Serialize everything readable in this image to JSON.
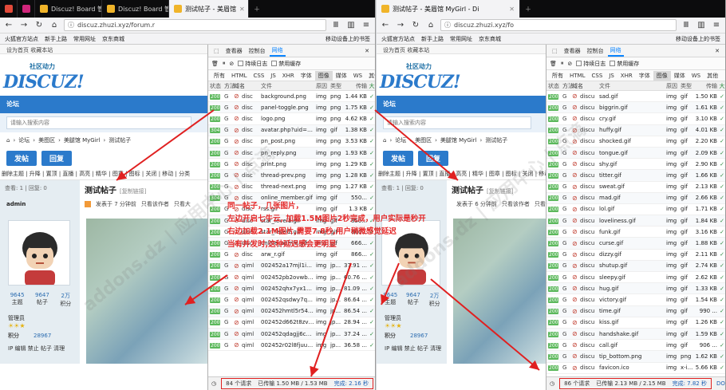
{
  "left": {
    "tabs": [
      {
        "label": "扰",
        "color": "#e24a3a",
        "active": false
      },
      {
        "label": "M",
        "color": "#d0267b",
        "active": false
      },
      {
        "label": "Discuz! Board 管",
        "color": "#f0b429",
        "active": false
      },
      {
        "label": "Discuz! Board 管",
        "color": "#f0b429",
        "active": false
      },
      {
        "label": "测试帖子 - 美眉馆",
        "color": "#f0b429",
        "active": true
      }
    ],
    "url": "discuz.zhuzi.xyz/forum.r",
    "bookmarks": [
      "火狐官方站点",
      "新手上路",
      "常用网址",
      "京东商城"
    ],
    "mobile_bm": "移动设备上的书签",
    "quicklinks": "设为首页  收藏本站",
    "logo_sub": "社区动力",
    "logo_main": "DISCUZ!",
    "forum_label": "论坛",
    "search_placeholder": "请输入搜索内容",
    "breadcrumb": [
      "论坛",
      "美图区",
      "美腿馆 MyGirl",
      "测试帖子"
    ],
    "post_btn": "发帖",
    "reply_btn": "回复",
    "types": "删除主题 | 升降 | 置顶 | 直播 | 高亮 | 精华 | 图章 | 图标 | 关闭 | 移动 | 分类",
    "stats": "查看: 1 | 回复: 0",
    "title": "测试帖子",
    "title_tag": "[复制链接]",
    "meta_time": "发表于 7 分钟前",
    "meta_author": "只看该作者",
    "meta_more": "只看大",
    "dev_tabs": [
      "查看器",
      "控制台",
      "网络"
    ],
    "dev_opts": [
      "持续日志",
      "禁用缓存"
    ],
    "filters": [
      "所有",
      "HTML",
      "CSS",
      "JS",
      "XHR",
      "字体",
      "图像",
      "媒体",
      "WS",
      "其他"
    ],
    "cols": [
      "状态",
      "方法",
      "域名",
      "文件",
      "原因",
      "类型",
      "传输",
      "大"
    ],
    "rows": [
      {
        "st": "200",
        "dom": "disc",
        "file": "background.png",
        "cause": "img",
        "type": "png",
        "size": "1.44 KB"
      },
      {
        "st": "200",
        "dom": "disc",
        "file": "panel-toggle.png",
        "cause": "img",
        "type": "png",
        "size": "1.75 KB"
      },
      {
        "st": "200",
        "dom": "disc",
        "file": "logo.png",
        "cause": "img",
        "type": "png",
        "size": "4.62 KB"
      },
      {
        "st": "304",
        "dom": "disc",
        "file": "avatar.php?uid=1...",
        "cause": "img",
        "type": "gif",
        "size": "1.38 KB"
      },
      {
        "st": "200",
        "dom": "disc",
        "file": "pn_post.png",
        "cause": "img",
        "type": "png",
        "size": "3.53 KB"
      },
      {
        "st": "200",
        "dom": "disc",
        "file": "pn_reply.png",
        "cause": "img",
        "type": "png",
        "size": "1.93 KB"
      },
      {
        "st": "200",
        "dom": "disc",
        "file": "print.png",
        "cause": "img",
        "type": "png",
        "size": "1.29 KB"
      },
      {
        "st": "200",
        "dom": "disc",
        "file": "thread-prev.png",
        "cause": "img",
        "type": "png",
        "size": "1.28 KB"
      },
      {
        "st": "200",
        "dom": "disc",
        "file": "thread-next.png",
        "cause": "img",
        "type": "png",
        "size": "1.27 KB"
      },
      {
        "st": "304",
        "dom": "disc",
        "file": "online_member.gif",
        "cause": "img",
        "type": "gif",
        "size": "550..."
      },
      {
        "st": "200",
        "dom": "disc",
        "file": "rss.gif",
        "cause": "img",
        "type": "gif",
        "size": "1.3 KB"
      },
      {
        "st": "200",
        "dom": "disc",
        "file": "star_level1.gif",
        "cause": "img",
        "type": "gif",
        "size": "850..."
      },
      {
        "st": "200",
        "dom": "disc",
        "file": "star_level2.gif",
        "cause": "img",
        "type": "gif",
        "size": "860..."
      },
      {
        "st": "200",
        "dom": "disc",
        "file": "online_admin.gif",
        "cause": "img",
        "type": "gif",
        "size": "666..."
      },
      {
        "st": "200",
        "dom": "disc",
        "file": "arw_r.gif",
        "cause": "img",
        "type": "gif",
        "size": "866..."
      },
      {
        "st": "200",
        "dom": "qiml",
        "file": "002452a17mjl1igx...",
        "cause": "img",
        "type": "jp...",
        "size": "37.91 ..."
      },
      {
        "st": "200",
        "dom": "qiml",
        "file": "002452pb2ovwbc...",
        "cause": "img",
        "type": "jp...",
        "size": "60.76 ..."
      },
      {
        "st": "200",
        "dom": "qiml",
        "file": "002452qhx7yx1q...",
        "cause": "img",
        "type": "jp...",
        "size": "81.09 ..."
      },
      {
        "st": "200",
        "dom": "qiml",
        "file": "002452qsdwy7qh...",
        "cause": "img",
        "type": "jp...",
        "size": "86.64 ..."
      },
      {
        "st": "200",
        "dom": "qiml",
        "file": "002452hmtl5r54rj...",
        "cause": "img",
        "type": "jp...",
        "size": "86.54 ..."
      },
      {
        "st": "200",
        "dom": "qiml",
        "file": "002452d662t8zva...",
        "cause": "img",
        "type": "jp...",
        "size": "28.94 ..."
      },
      {
        "st": "200",
        "dom": "qiml",
        "file": "002452qdagjj6csq...",
        "cause": "img",
        "type": "jp...",
        "size": "37.24 ..."
      },
      {
        "st": "200",
        "dom": "qiml",
        "file": "002452r02l8fjuu9...",
        "cause": "img",
        "type": "jp...",
        "size": "36.58 ..."
      }
    ],
    "footer_req": "84 个请求",
    "footer_xfer": "已传输 1.50 MB / 1.53 MB",
    "footer_done": "完成: 2.16 秒",
    "user": {
      "name": "admin",
      "topics": "9645",
      "posts": "9647",
      "credit": "2万",
      "topics_lbl": "主题",
      "posts_lbl": "帖子",
      "credit_lbl": "积分",
      "role": "管理员",
      "score_lbl": "积分",
      "score": "28967",
      "links": "IP 编辑 禁止 帖子 清理"
    }
  },
  "right": {
    "tab": "测试帖子 - 美眉馆 MyGirl - Di",
    "url": "discuz.zhuzi.xyz/fo",
    "bookmarks": [
      "火狐官方站点",
      "新手上路",
      "常用网址",
      "京东商城"
    ],
    "mobile_bm": "移动设备上的书签",
    "quicklinks": "设为首页  收藏本站",
    "logo_sub": "社区动力",
    "logo_main": "DISCUZ!",
    "forum_label": "论坛",
    "search_placeholder": "请输入搜索内容",
    "breadcrumb": [
      "论坛",
      "美图区",
      "美腿馆 MyGirl",
      "测试帖子"
    ],
    "post_btn": "发帖",
    "reply_btn": "回复",
    "types": "删除主题 | 升降 | 置顶 | 直播 | 高亮 | 精华 | 图章 | 图标 | 关闭 | 移动",
    "stats": "查看: 1 | 回复: 0",
    "title": "测试帖子",
    "title_tag": "[复制链接]",
    "meta_time": "发表于 6 分钟前",
    "meta_author": "只看该作者",
    "meta_more": "只看",
    "dev_tabs": [
      "查看器",
      "控制台",
      "网络"
    ],
    "dev_opts": [
      "持续日志",
      "禁用缓存"
    ],
    "filters": [
      "所有",
      "HTML",
      "CSS",
      "JS",
      "XHR",
      "字体",
      "图像",
      "媒体",
      "WS",
      "其他"
    ],
    "cols": [
      "状态",
      "方法",
      "域名",
      "文件",
      "原因",
      "类型",
      "传输",
      "大"
    ],
    "rows": [
      {
        "st": "200",
        "dom": "discu",
        "file": "sad.gif",
        "cause": "img",
        "type": "gif",
        "size": "1.50 KB"
      },
      {
        "st": "200",
        "dom": "discu",
        "file": "biggrin.gif",
        "cause": "img",
        "type": "gif",
        "size": "1.61 KB"
      },
      {
        "st": "200",
        "dom": "discu",
        "file": "cry.gif",
        "cause": "img",
        "type": "gif",
        "size": "3.10 KB"
      },
      {
        "st": "200",
        "dom": "discu",
        "file": "huffy.gif",
        "cause": "img",
        "type": "gif",
        "size": "4.01 KB"
      },
      {
        "st": "200",
        "dom": "discu",
        "file": "shocked.gif",
        "cause": "img",
        "type": "gif",
        "size": "2.20 KB"
      },
      {
        "st": "200",
        "dom": "discu",
        "file": "tongue.gif",
        "cause": "img",
        "type": "gif",
        "size": "2.09 KB"
      },
      {
        "st": "200",
        "dom": "discu",
        "file": "shy.gif",
        "cause": "img",
        "type": "gif",
        "size": "2.90 KB"
      },
      {
        "st": "200",
        "dom": "discu",
        "file": "titter.gif",
        "cause": "img",
        "type": "gif",
        "size": "1.66 KB"
      },
      {
        "st": "200",
        "dom": "discu",
        "file": "sweat.gif",
        "cause": "img",
        "type": "gif",
        "size": "2.13 KB"
      },
      {
        "st": "200",
        "dom": "discu",
        "file": "mad.gif",
        "cause": "img",
        "type": "gif",
        "size": "2.66 KB"
      },
      {
        "st": "200",
        "dom": "discu",
        "file": "lol.gif",
        "cause": "img",
        "type": "gif",
        "size": "1.71 KB"
      },
      {
        "st": "200",
        "dom": "discu",
        "file": "loveliness.gif",
        "cause": "img",
        "type": "gif",
        "size": "1.84 KB"
      },
      {
        "st": "200",
        "dom": "discu",
        "file": "funk.gif",
        "cause": "img",
        "type": "gif",
        "size": "3.16 KB"
      },
      {
        "st": "200",
        "dom": "discu",
        "file": "curse.gif",
        "cause": "img",
        "type": "gif",
        "size": "1.88 KB"
      },
      {
        "st": "200",
        "dom": "discu",
        "file": "dizzy.gif",
        "cause": "img",
        "type": "gif",
        "size": "2.11 KB"
      },
      {
        "st": "200",
        "dom": "discu",
        "file": "shutup.gif",
        "cause": "img",
        "type": "gif",
        "size": "2.74 KB"
      },
      {
        "st": "200",
        "dom": "discu",
        "file": "sleepy.gif",
        "cause": "img",
        "type": "gif",
        "size": "2.62 KB"
      },
      {
        "st": "200",
        "dom": "discu",
        "file": "hug.gif",
        "cause": "img",
        "type": "gif",
        "size": "1.33 KB"
      },
      {
        "st": "200",
        "dom": "discu",
        "file": "victory.gif",
        "cause": "img",
        "type": "gif",
        "size": "1.54 KB"
      },
      {
        "st": "200",
        "dom": "discu",
        "file": "time.gif",
        "cause": "img",
        "type": "gif",
        "size": "990 ..."
      },
      {
        "st": "200",
        "dom": "discu",
        "file": "kiss.gif",
        "cause": "img",
        "type": "gif",
        "size": "1.26 KB"
      },
      {
        "st": "200",
        "dom": "discu",
        "file": "handshake.gif",
        "cause": "img",
        "type": "gif",
        "size": "1.59 KB"
      },
      {
        "st": "200",
        "dom": "discu",
        "file": "call.gif",
        "cause": "img",
        "type": "gif",
        "size": "906 ..."
      },
      {
        "st": "200",
        "dom": "discu",
        "file": "tip_bottom.png",
        "cause": "img",
        "type": "png",
        "size": "1.62 KB"
      },
      {
        "st": "200",
        "dom": "discu",
        "file": "favicon.ico",
        "cause": "img",
        "type": "x-i...",
        "size": "5.66 KB"
      }
    ],
    "footer_req": "86 个请求",
    "footer_xfer": "已传输 2.13 MB / 2.15 MB",
    "footer_done": "完成: 7.82 秒",
    "footer_tail": "DOM",
    "user": {
      "topics": "9645",
      "posts": "9647",
      "credit": "2万",
      "topics_lbl": "主题",
      "posts_lbl": "帖子",
      "credit_lbl": "积分",
      "role": "管理员",
      "score_lbl": "积分",
      "score": "28967",
      "links": "IP 编辑 禁止 帖子 清理"
    }
  },
  "annotation": {
    "line1": "同一帖子，几张图片，",
    "line2": "左边开启七牛云, 加载1.5M图片2秒完成，用户实际是秒开",
    "line3": "右边加载2.1M图片,需要7.8秒,用户稍微感觉延迟",
    "line4": "当有并发时,这种延迟感会更明显"
  },
  "watermark": "addons.dz | 应用中心 | 点滴"
}
